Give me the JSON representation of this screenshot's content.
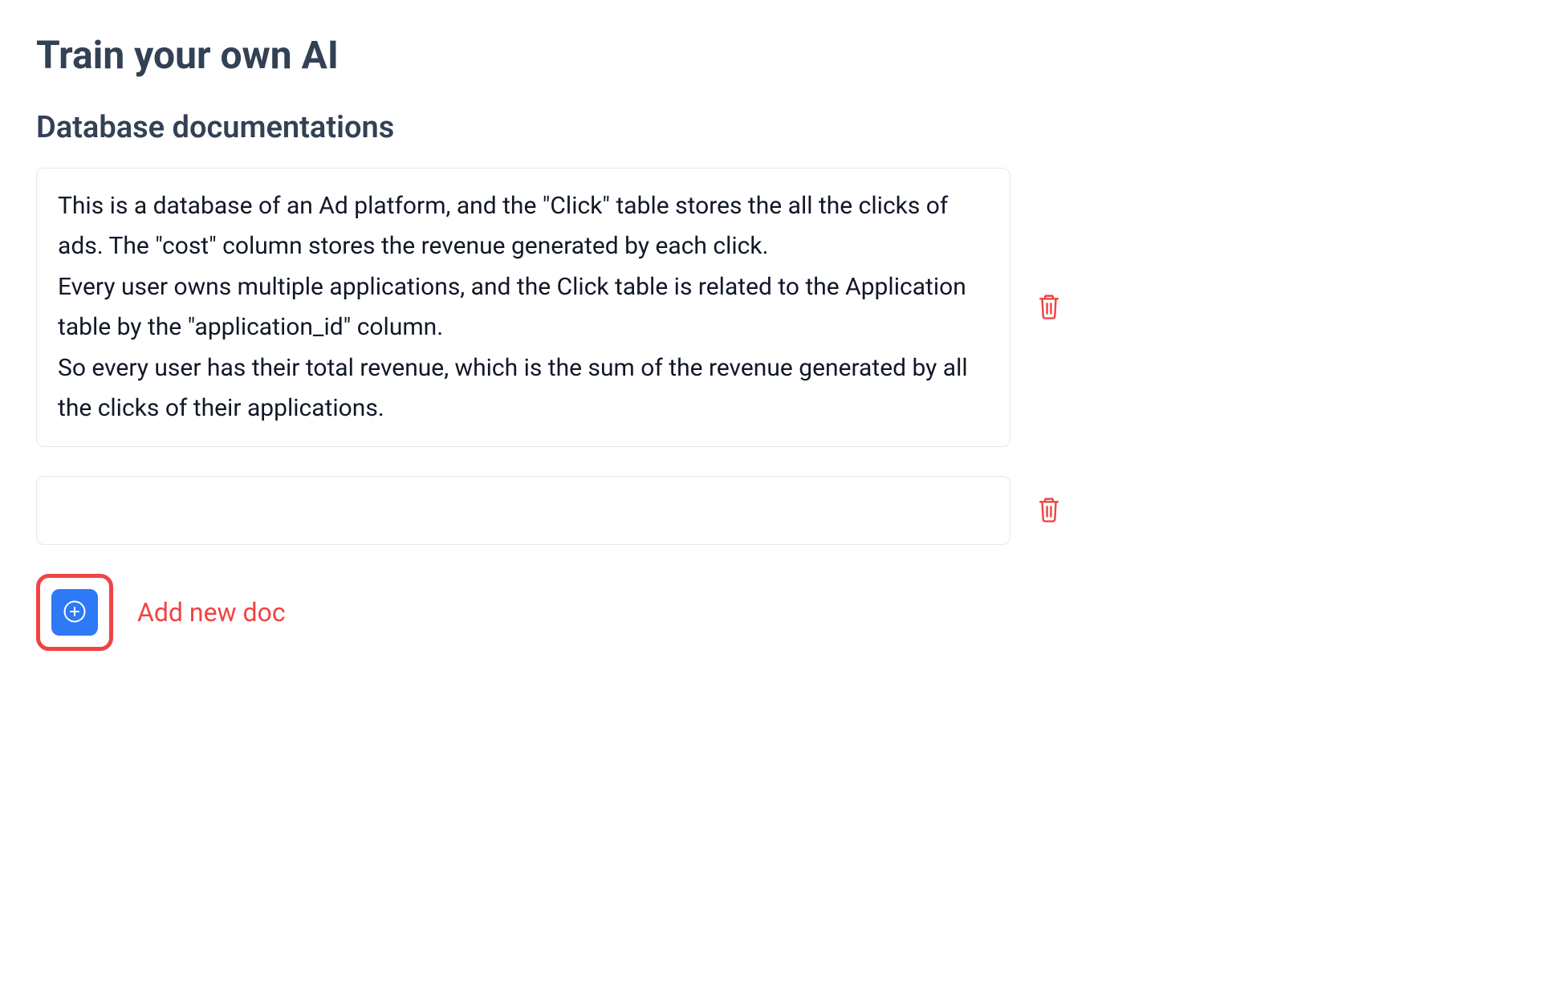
{
  "title": "Train your own AI",
  "section_title": "Database documentations",
  "docs": [
    {
      "content": "This is a database of an Ad platform, and the \"Click\" table stores the all the clicks of ads. The \"cost\" column stores the revenue generated by each click.\nEvery user owns multiple applications, and the Click table is related to the Application table by the \"application_id\" column.\nSo every user has their total revenue, which is the sum of the revenue generated by all the clicks of their applications."
    },
    {
      "content": ""
    }
  ],
  "add_label": "Add new doc",
  "colors": {
    "accent_blue": "#2e79f6",
    "accent_red": "#ef4444",
    "text_heading": "#334155",
    "border": "#e5e7eb"
  },
  "icons": {
    "trash": "trash-icon",
    "plus_circle": "plus-circle-icon"
  }
}
